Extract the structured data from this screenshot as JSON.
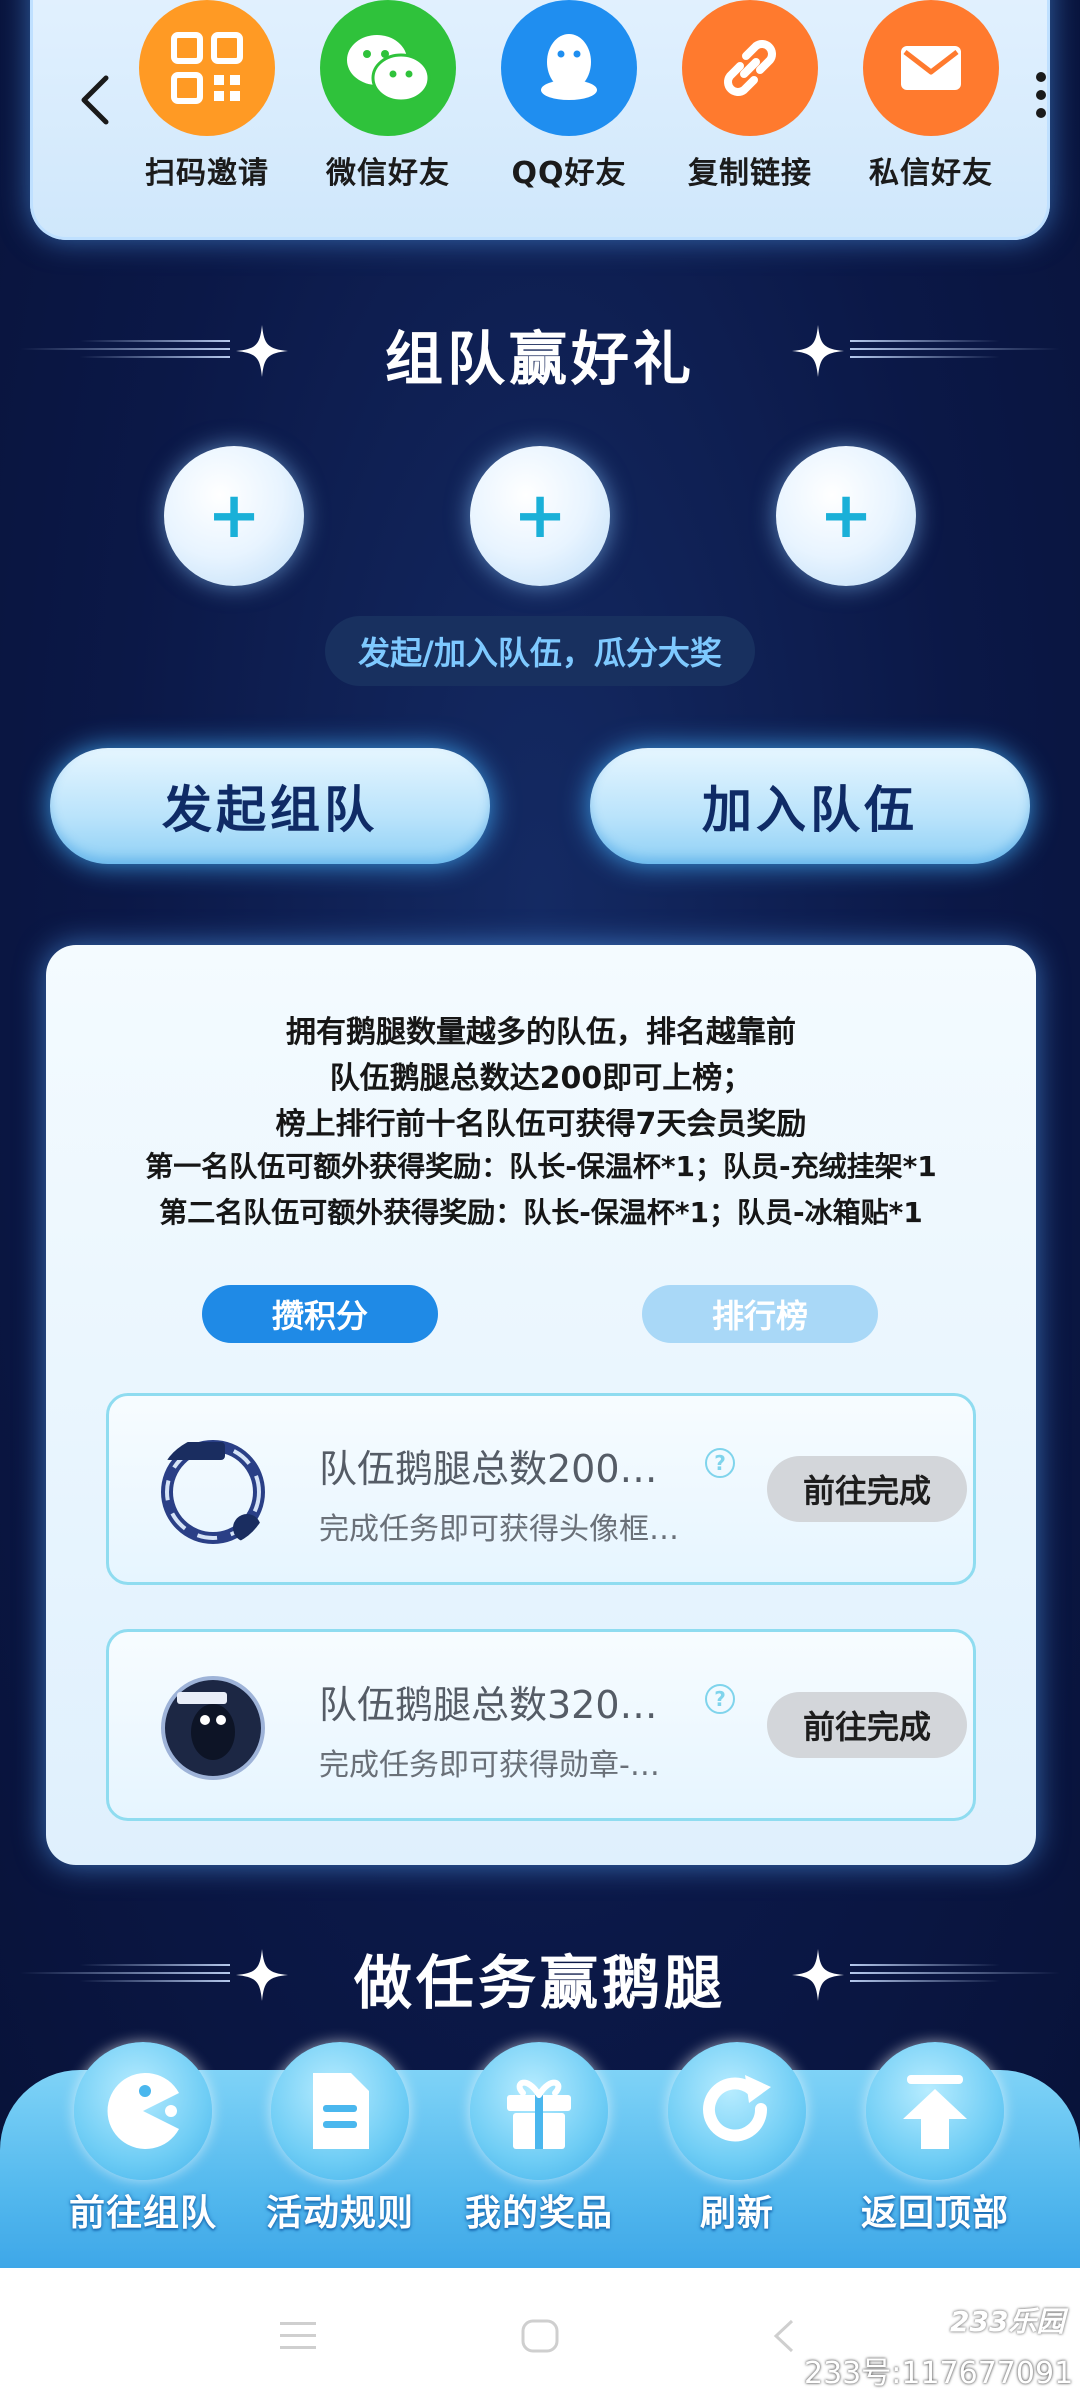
{
  "share": {
    "items": [
      {
        "label": "扫码邀请",
        "icon": "qr-code-icon",
        "color": "#ff9a24"
      },
      {
        "label": "微信好友",
        "icon": "wechat-icon",
        "color": "#2fc23b"
      },
      {
        "label": "QQ好友",
        "icon": "qq-penguin-icon",
        "color": "#1f8ef0"
      },
      {
        "label": "复制链接",
        "icon": "link-icon",
        "color": "#ff7a2e"
      },
      {
        "label": "私信好友",
        "icon": "mail-icon",
        "color": "#ff7a2e"
      }
    ]
  },
  "team": {
    "title": "组队赢好礼",
    "hint": "发起/加入队伍，瓜分大奖",
    "slot_symbol": "+",
    "create_label": "发起组队",
    "join_label": "加入队伍"
  },
  "rules": {
    "lines": [
      "拥有鹅腿数量越多的队伍，排名越靠前",
      "队伍鹅腿总数达200即可上榜；",
      "榜上排行前十名队伍可获得7天会员奖励",
      "第一名队伍可额外获得奖励：队长-保温杯*1；队员-充绒挂架*1",
      "第二名队伍可额外获得奖励：队长-保温杯*1；队员-冰箱贴*1"
    ],
    "tabs": [
      {
        "label": "攒积分",
        "active": true
      },
      {
        "label": "排行榜",
        "active": false
      }
    ]
  },
  "tasks": [
    {
      "title": "队伍鹅腿总数200…",
      "subtitle": "完成任务即可获得头像框…",
      "help": "?",
      "button": "前往完成"
    },
    {
      "title": "队伍鹅腿总数320…",
      "subtitle": "完成任务即可获得勋章-…",
      "help": "?",
      "button": "前往完成"
    }
  ],
  "earn": {
    "title": "做任务赢鹅腿"
  },
  "bottom_nav": [
    {
      "label": "前往组队",
      "icon": "pacman-icon"
    },
    {
      "label": "活动规则",
      "icon": "document-icon"
    },
    {
      "label": "我的奖品",
      "icon": "gift-icon"
    },
    {
      "label": "刷新",
      "icon": "refresh-icon"
    },
    {
      "label": "返回顶部",
      "icon": "back-to-top-icon"
    }
  ],
  "watermark": {
    "logo": "233乐园",
    "id": "233号:117677091"
  },
  "colors": {
    "accent": "#1f8ae6",
    "accent_light": "#a9d8f7",
    "background": "#0b1847",
    "task_border": "#8fdcf0"
  }
}
